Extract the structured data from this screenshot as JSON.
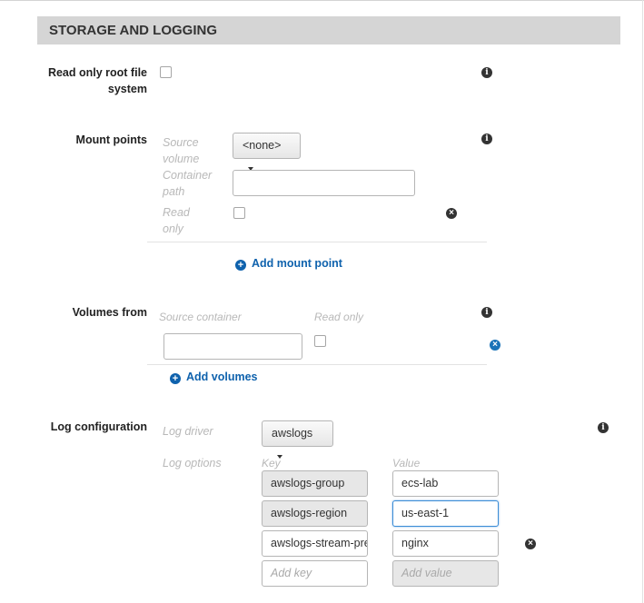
{
  "section": {
    "title": "STORAGE AND LOGGING"
  },
  "read_only_root": {
    "label": "Read only root file system",
    "checked": false
  },
  "mount_points": {
    "label": "Mount points",
    "source_volume_label": "Source volume",
    "source_volume_value": "<none>",
    "container_path_label": "Container path",
    "container_path_value": "",
    "read_only_label": "Read only",
    "add_label": "Add mount point"
  },
  "volumes_from": {
    "label": "Volumes from",
    "source_container_label": "Source container",
    "read_only_label": "Read only",
    "source_container_value": "",
    "add_label": "Add volumes"
  },
  "log_configuration": {
    "label": "Log configuration",
    "log_driver_label": "Log driver",
    "log_driver_value": "awslogs",
    "log_options_label": "Log options",
    "key_header": "Key",
    "value_header": "Value",
    "options": [
      {
        "key": "awslogs-group",
        "value": "ecs-lab"
      },
      {
        "key": "awslogs-region",
        "value": "us-east-1"
      },
      {
        "key": "awslogs-stream-prefix",
        "value": "nginx"
      }
    ],
    "new_key_placeholder": "Add key",
    "new_value_placeholder": "Add value"
  },
  "icons": {
    "info": "info-icon",
    "remove": "remove-icon",
    "add": "plus-circle-icon",
    "dropdown": "caret-down-icon"
  },
  "colors": {
    "link": "#0f62ad",
    "header_bg": "#d5d5d5",
    "focus": "#3b8cd6"
  }
}
